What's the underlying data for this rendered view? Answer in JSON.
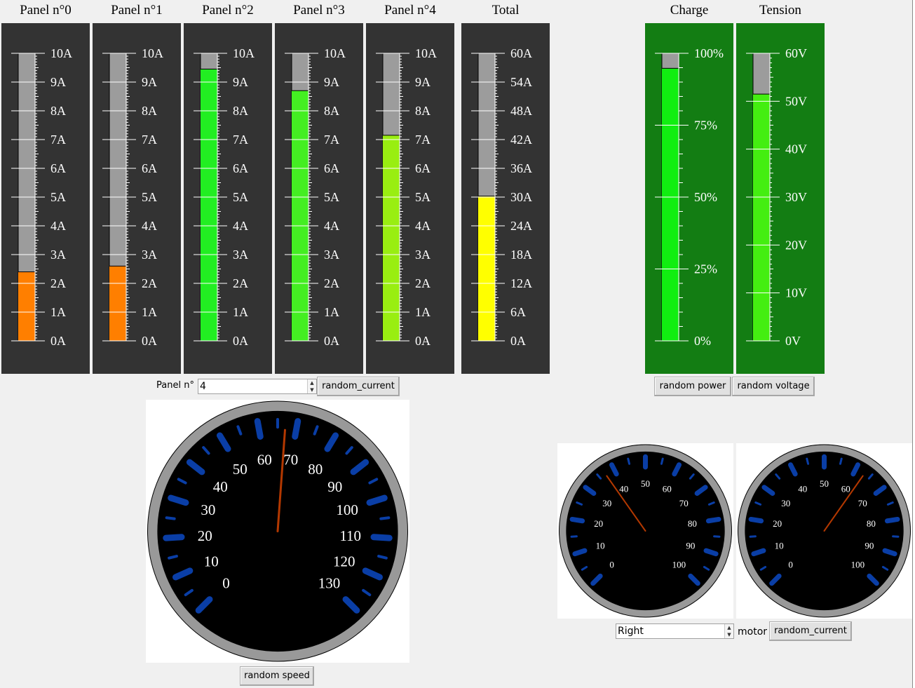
{
  "colors": {
    "panel_bg": "#333333",
    "green_bg": "#137d13",
    "track": "#9c9c9c",
    "dial_tick": "#0a3ea6",
    "needle": "#b33800"
  },
  "gauges": [
    {
      "title": "Panel n°0",
      "value": 2.4,
      "max": 10,
      "color": "#ff7f00",
      "labels": [
        "10A",
        "9A",
        "8A",
        "7A",
        "6A",
        "5A",
        "4A",
        "3A",
        "2A",
        "1A",
        "0A"
      ]
    },
    {
      "title": "Panel n°1",
      "value": 2.6,
      "max": 10,
      "color": "#ff7f00",
      "labels": [
        "10A",
        "9A",
        "8A",
        "7A",
        "6A",
        "5A",
        "4A",
        "3A",
        "2A",
        "1A",
        "0A"
      ]
    },
    {
      "title": "Panel n°2",
      "value": 9.45,
      "max": 10,
      "color": "#22ee22",
      "labels": [
        "10A",
        "9A",
        "8A",
        "7A",
        "6A",
        "5A",
        "4A",
        "3A",
        "2A",
        "1A",
        "0A"
      ]
    },
    {
      "title": "Panel n°3",
      "value": 8.7,
      "max": 10,
      "color": "#44ee22",
      "labels": [
        "10A",
        "9A",
        "8A",
        "7A",
        "6A",
        "5A",
        "4A",
        "3A",
        "2A",
        "1A",
        "0A"
      ]
    },
    {
      "title": "Panel n°4",
      "value": 7.15,
      "max": 10,
      "color": "#99ee11",
      "labels": [
        "10A",
        "9A",
        "8A",
        "7A",
        "6A",
        "5A",
        "4A",
        "3A",
        "2A",
        "1A",
        "0A"
      ]
    },
    {
      "title": "Total",
      "value": 30.2,
      "max": 60,
      "color": "#ffff00",
      "labels": [
        "60A",
        "54A",
        "48A",
        "42A",
        "36A",
        "30A",
        "24A",
        "18A",
        "12A",
        "6A",
        "0A"
      ]
    },
    {
      "title": "Charge",
      "value": 94.8,
      "max": 100,
      "color": "#11ee11",
      "labels": [
        "100%",
        "75%",
        "50%",
        "25%",
        "0%"
      ]
    },
    {
      "title": "Tension",
      "value": 51.5,
      "max": 60,
      "color": "#44ee11",
      "labels": [
        "60V",
        "50V",
        "40V",
        "30V",
        "20V",
        "10V",
        "0V"
      ]
    }
  ],
  "panel_control": {
    "label": "Panel n°",
    "value": "4",
    "button": "random_current"
  },
  "charge_button": "random power",
  "tension_button": "random voltage",
  "speedometer": {
    "labels": [
      "0",
      "10",
      "20",
      "30",
      "40",
      "50",
      "60",
      "70",
      "80",
      "90",
      "100",
      "110",
      "120",
      "130"
    ],
    "max": 130,
    "value": 67,
    "button": "random speed"
  },
  "motor_left": {
    "labels": [
      "0",
      "10",
      "20",
      "30",
      "40",
      "50",
      "60",
      "70",
      "80",
      "90",
      "100"
    ],
    "max": 100,
    "value": 37
  },
  "motor_right": {
    "labels": [
      "0",
      "10",
      "20",
      "30",
      "40",
      "50",
      "60",
      "70",
      "80",
      "90",
      "100"
    ],
    "max": 100,
    "value": 63
  },
  "motor_control": {
    "value": "Right",
    "label": "motor",
    "button": "random_current"
  }
}
